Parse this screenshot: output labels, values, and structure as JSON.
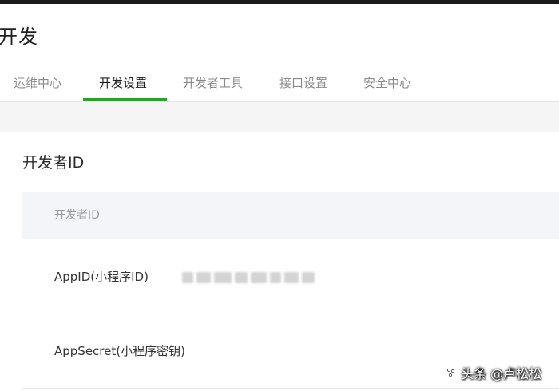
{
  "page": {
    "title": "开发"
  },
  "tabs": [
    {
      "label": "运维中心",
      "active": false
    },
    {
      "label": "开发设置",
      "active": true
    },
    {
      "label": "开发者工具",
      "active": false
    },
    {
      "label": "接口设置",
      "active": false
    },
    {
      "label": "安全中心",
      "active": false
    }
  ],
  "section": {
    "title": "开发者ID",
    "table_header": "开发者ID",
    "rows": [
      {
        "label": "AppID(小程序ID)",
        "value_masked": true
      },
      {
        "label": "AppSecret(小程序密钥)"
      }
    ]
  },
  "watermark": {
    "text": "头条 @卢松松",
    "icon": "toutiao-logo-icon"
  },
  "colors": {
    "accent": "#1aad19",
    "text": "#353535",
    "muted": "#8a8a8a",
    "header_bg": "#f4f5f9"
  }
}
